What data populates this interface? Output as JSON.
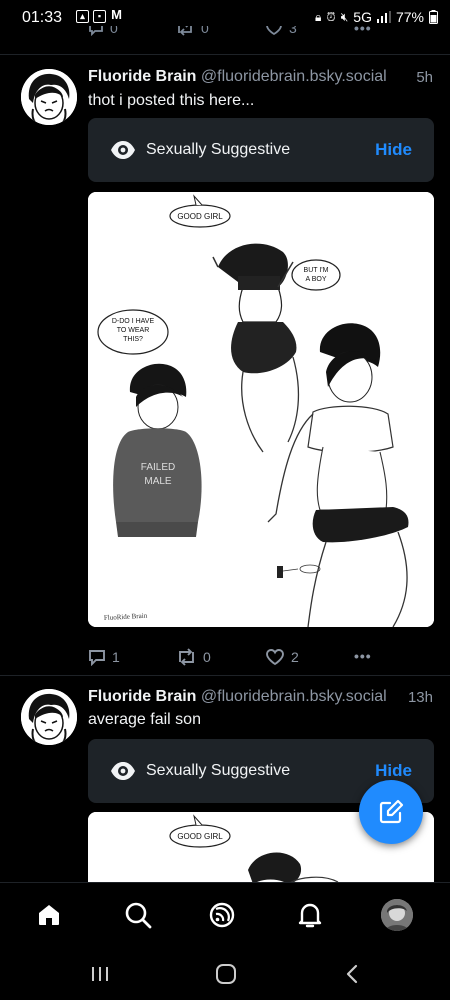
{
  "status_bar": {
    "time": "01:33",
    "network": "5G",
    "battery": "77%"
  },
  "previous_post_actions": {
    "replies": "0",
    "reposts": "0",
    "likes": "3"
  },
  "posts": [
    {
      "author": "Fluoride Brain",
      "handle": "@fluoridebrain.bsky.social",
      "time": "5h",
      "text": "thot i posted this here...",
      "content_warning": {
        "label": "Sexually Suggestive",
        "action": "Hide"
      },
      "image": {
        "bubble_1": "GOOD GIRL",
        "bubble_2": "BUT I'M A BOY",
        "bubble_3": "D-DO I HAVE TO WEAR THIS?",
        "hoodie_text": "FAILED MALE",
        "signature": "FluoRide Brain"
      },
      "replies": "1",
      "reposts": "0",
      "likes": "2"
    },
    {
      "author": "Fluoride Brain",
      "handle": "@fluoridebrain.bsky.social",
      "time": "13h",
      "text": "average fail son",
      "content_warning": {
        "label": "Sexually Suggestive",
        "action": "Hide"
      },
      "image": {
        "bubble_1": "GOOD GIRL"
      }
    }
  ],
  "bottom_nav": [
    "home-icon",
    "search-icon",
    "feeds-icon",
    "notifications-icon",
    "profile-avatar"
  ],
  "system_nav": [
    "recents-button",
    "home-button",
    "back-button"
  ],
  "colors": {
    "accent": "#208bfe",
    "background": "#000000",
    "muted": "#8d96a3",
    "cw_bg": "#1e2328"
  }
}
